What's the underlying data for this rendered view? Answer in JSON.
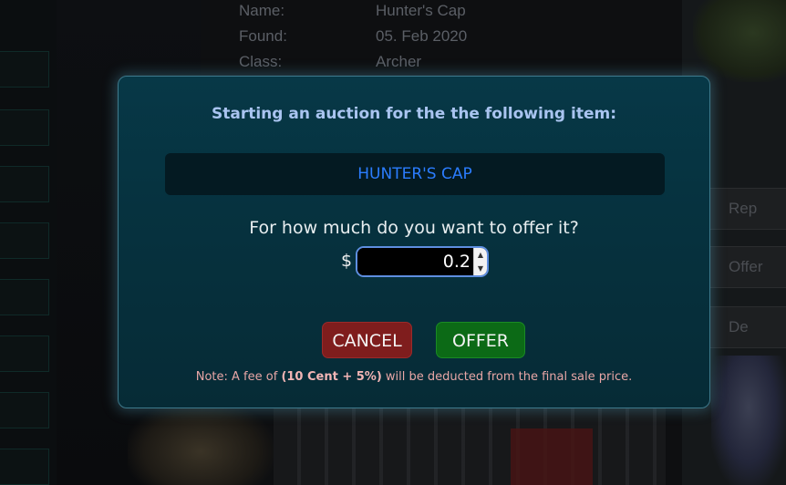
{
  "background": {
    "item_info": [
      {
        "key": "Name:",
        "value": "Hunter's Cap"
      },
      {
        "key": "Found:",
        "value": "05. Feb 2020"
      },
      {
        "key": "Class:",
        "value": "Archer"
      }
    ],
    "right_buttons": [
      "Rep",
      "Offer",
      "De"
    ]
  },
  "dialog": {
    "title": "Starting an auction for the the following item:",
    "item_name": "HUNTER'S CAP",
    "question": "For how much do you want to offer it?",
    "currency_symbol": "$",
    "price_value": "0.2",
    "cancel_label": "CANCEL",
    "offer_label": "OFFER",
    "note_prefix": "Note: A fee of ",
    "note_fee": "(10 Cent + 5%)",
    "note_suffix": " will be deducted from the final sale price."
  },
  "colors": {
    "item_name": "#2b7dff",
    "cancel_button": "#7f1d1d",
    "offer_button": "#0c6a16",
    "note_text": "#e8a6a6",
    "title_text": "#a9c4f0"
  },
  "icons": {
    "stepper_up": "caret-up-icon",
    "stepper_down": "caret-down-icon"
  }
}
